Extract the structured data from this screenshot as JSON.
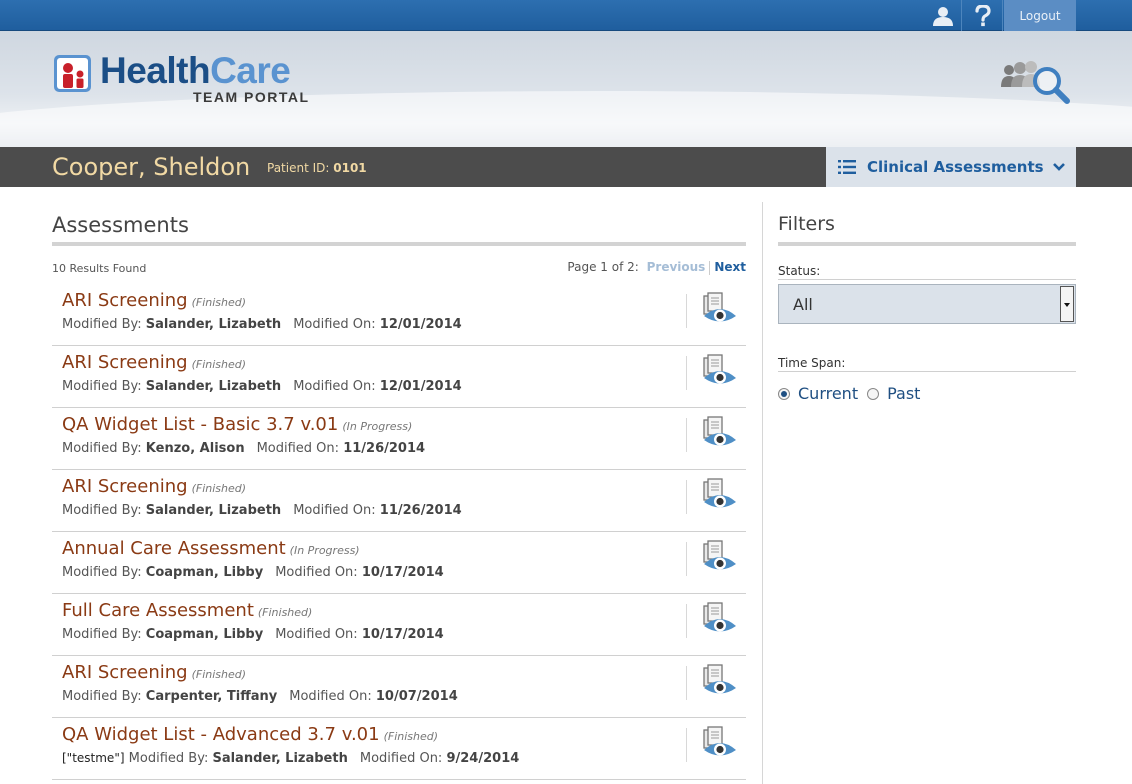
{
  "topbar": {
    "user_icon": "user-icon",
    "help_icon": "question-mark-icon",
    "logout_label": "Logout"
  },
  "header": {
    "logo_health": "Health",
    "logo_care": "Care",
    "logo_sub": "TEAM PORTAL",
    "search_icon": "patient-search-icon"
  },
  "patient": {
    "name": "Cooper, Sheldon",
    "id_label": "Patient ID:",
    "id_value": "0101"
  },
  "section_menu": {
    "label": "Clinical Assessments",
    "icon": "list-icon",
    "chevron": "chevron-down-icon"
  },
  "assessments": {
    "heading": "Assessments",
    "results": "10 Results Found",
    "page_info": "Page 1 of 2:",
    "prev_label": "Previous",
    "next_label": "Next",
    "modified_by_label": "Modified By:",
    "modified_on_label": "Modified On:",
    "items": [
      {
        "title": "ARI Screening",
        "status": "(Finished)",
        "tag": "",
        "by": "Salander, Lizabeth",
        "on": "12/01/2014"
      },
      {
        "title": "ARI Screening",
        "status": "(Finished)",
        "tag": "",
        "by": "Salander, Lizabeth",
        "on": "12/01/2014"
      },
      {
        "title": "QA Widget List - Basic 3.7 v.01",
        "status": "(In Progress)",
        "tag": "",
        "by": "Kenzo, Alison",
        "on": "11/26/2014"
      },
      {
        "title": "ARI Screening",
        "status": "(Finished)",
        "tag": "",
        "by": "Salander, Lizabeth",
        "on": "11/26/2014"
      },
      {
        "title": "Annual Care Assessment",
        "status": "(In Progress)",
        "tag": "",
        "by": "Coapman, Libby",
        "on": "10/17/2014"
      },
      {
        "title": "Full Care Assessment",
        "status": "(Finished)",
        "tag": "",
        "by": "Coapman, Libby",
        "on": "10/17/2014"
      },
      {
        "title": "ARI Screening",
        "status": "(Finished)",
        "tag": "",
        "by": "Carpenter, Tiffany",
        "on": "10/07/2014"
      },
      {
        "title": "QA Widget List - Advanced 3.7 v.01",
        "status": "(Finished)",
        "tag": "[\"testme\"]",
        "by": "Salander, Lizabeth",
        "on": "9/24/2014"
      }
    ]
  },
  "filters": {
    "heading": "Filters",
    "status_label": "Status:",
    "status_value": "All",
    "timespan_label": "Time Span:",
    "options": [
      "Current",
      "Past"
    ],
    "selected": "Current"
  },
  "colors": {
    "brand_blue": "#1f5e9e",
    "title_brown": "#8a3a14",
    "patient_gold": "#f1d9a4"
  }
}
